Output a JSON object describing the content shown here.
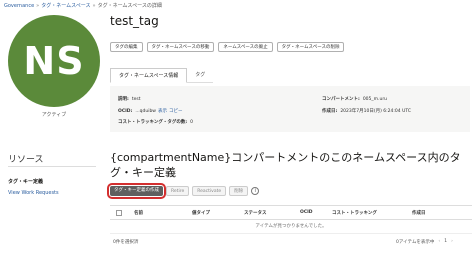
{
  "breadcrumb": [
    "Governance",
    "タグ・ネームスペース",
    "タグ・ネームスペースの詳細"
  ],
  "avatar": {
    "initials": "NS",
    "color": "#5b8a3a",
    "state": "アクティブ"
  },
  "title": "test_tag",
  "actions": [
    "タグの編集",
    "タグ・ネームスペースの移動",
    "ネームスペースの廃止",
    "タグ・ネームスペースの削除"
  ],
  "tabs": [
    "タグ・ネームスペース情報",
    "タグ"
  ],
  "info": {
    "desc_label": "説明:",
    "desc_value": "test",
    "ocid_label": "OCID:",
    "ocid_value": "...qduibw",
    "ocid_show": "表示",
    "ocid_copy": "コピー",
    "cost_label": "コスト・トラッキング・タグの数:",
    "cost_value": "0",
    "compartment_label": "コンパートメント:",
    "compartment_value": "005_m.uru",
    "created_label": "作成日:",
    "created_value": "2023年7月10日(月) 6:24:04 UTC"
  },
  "resources": {
    "title": "リソース",
    "active": "タグ・キー定義",
    "link": "View Work Requests"
  },
  "section_title": "{compartmentName}コンパートメントのこのネームスペース内のタグ・キー定義",
  "table_actions": {
    "create": "タグ・キー定義の作成",
    "retire": "Retire",
    "reactivate": "Reactivate",
    "delete": "削除"
  },
  "table": {
    "columns": [
      "名前",
      "値タイプ",
      "ステータス",
      "OCID",
      "コスト・トラッキング",
      "作成日"
    ],
    "empty": "アイテムが見つかりませんでした。"
  },
  "footer": {
    "selected": "0件を選択済",
    "shown": "0アイテムを表示中",
    "prev": "‹",
    "page": "1",
    "next": "›"
  },
  "colors": {
    "accent": "#2a5d9f",
    "highlight": "#d32f2f",
    "primary_button": "#5f5f5f"
  }
}
